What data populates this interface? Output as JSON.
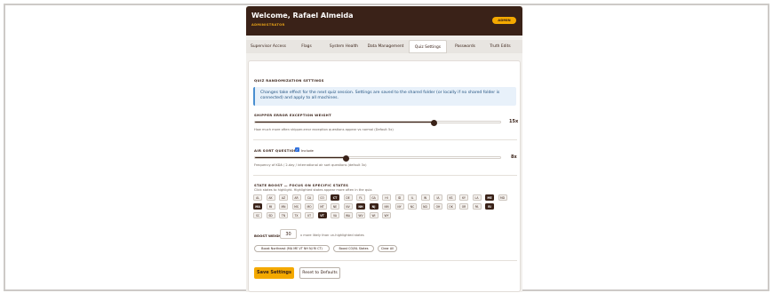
{
  "header": {
    "title": "Welcome, Rafael Almeida",
    "role": "ADMINISTRATOR",
    "badge": "ADMIN"
  },
  "tabs": [
    {
      "label": "Supervisor Access"
    },
    {
      "label": "Flags"
    },
    {
      "label": "System Health"
    },
    {
      "label": "Data Management"
    },
    {
      "label": "Quiz Settings",
      "active": true
    },
    {
      "label": "Passwords"
    },
    {
      "label": "Truth Edits"
    }
  ],
  "settings": {
    "section_title": "QUIZ RANDOMIZATION SETTINGS",
    "info": "Changes take effect for the next quiz session. Settings are saved to the shared folder (or locally if no shared folder is connected) and apply to all machines.",
    "shipper": {
      "title": "SHIPPER ERROR EXCEPTION WEIGHT",
      "value": 15,
      "value_label": "15x",
      "fraction": 0.73,
      "description": "How much more often shipper-error exception questions appear vs normal (Default 5x)"
    },
    "air": {
      "title": "AIR SORT QUESTIONS",
      "checkbox_label": "Include",
      "checked": true,
      "value": 8,
      "value_label": "8x",
      "fraction": 0.37,
      "description": "Frequency of KDA / 2-day / international air sort questions (default 3x)"
    },
    "states": {
      "title": "STATE BOOST — FOCUS ON SPECIFIC STATES",
      "description": "Click states to highlight. Highlighted states appear more often in the quiz.",
      "list": [
        {
          "code": "AL",
          "sel": false
        },
        {
          "code": "AK",
          "sel": false
        },
        {
          "code": "AZ",
          "sel": false
        },
        {
          "code": "AR",
          "sel": false
        },
        {
          "code": "CA",
          "sel": false
        },
        {
          "code": "CO",
          "sel": false
        },
        {
          "code": "CT",
          "sel": true
        },
        {
          "code": "DE",
          "sel": false
        },
        {
          "code": "FL",
          "sel": false
        },
        {
          "code": "GA",
          "sel": false
        },
        {
          "code": "HI",
          "sel": false
        },
        {
          "code": "ID",
          "sel": false
        },
        {
          "code": "IL",
          "sel": false
        },
        {
          "code": "IN",
          "sel": false
        },
        {
          "code": "IA",
          "sel": false
        },
        {
          "code": "KS",
          "sel": false
        },
        {
          "code": "KY",
          "sel": false
        },
        {
          "code": "LA",
          "sel": false
        },
        {
          "code": "ME",
          "sel": true
        },
        {
          "code": "MD",
          "sel": false
        },
        {
          "code": "MA",
          "sel": true
        },
        {
          "code": "MI",
          "sel": false
        },
        {
          "code": "MN",
          "sel": false
        },
        {
          "code": "MS",
          "sel": false
        },
        {
          "code": "MO",
          "sel": false
        },
        {
          "code": "MT",
          "sel": false
        },
        {
          "code": "NE",
          "sel": false
        },
        {
          "code": "NV",
          "sel": false
        },
        {
          "code": "NH",
          "sel": true
        },
        {
          "code": "NJ",
          "sel": true
        },
        {
          "code": "NM",
          "sel": false
        },
        {
          "code": "NY",
          "sel": false
        },
        {
          "code": "NC",
          "sel": false
        },
        {
          "code": "ND",
          "sel": false
        },
        {
          "code": "OH",
          "sel": false
        },
        {
          "code": "OK",
          "sel": false
        },
        {
          "code": "OR",
          "sel": false
        },
        {
          "code": "PA",
          "sel": false
        },
        {
          "code": "RI",
          "sel": true
        },
        {
          "code": "SC",
          "sel": false
        },
        {
          "code": "SD",
          "sel": false
        },
        {
          "code": "TN",
          "sel": false
        },
        {
          "code": "TX",
          "sel": false
        },
        {
          "code": "UT",
          "sel": false
        },
        {
          "code": "VT",
          "sel": true
        },
        {
          "code": "VA",
          "sel": false
        },
        {
          "code": "WA",
          "sel": false
        },
        {
          "code": "WV",
          "sel": false
        },
        {
          "code": "WI",
          "sel": false
        },
        {
          "code": "WY",
          "sel": false
        }
      ]
    },
    "boost": {
      "label": "BOOST WEIGHT:",
      "value": "30",
      "note": "x more likely than un-highlighted states"
    },
    "quick_buttons": [
      {
        "label": "Boost Northeast (MA ME VT NH NJ RI CT)"
      },
      {
        "label": "Boost CO/NL States"
      },
      {
        "label": "Clear All"
      }
    ],
    "save_label": "Save Settings",
    "reset_label": "Reset to Defaults"
  }
}
